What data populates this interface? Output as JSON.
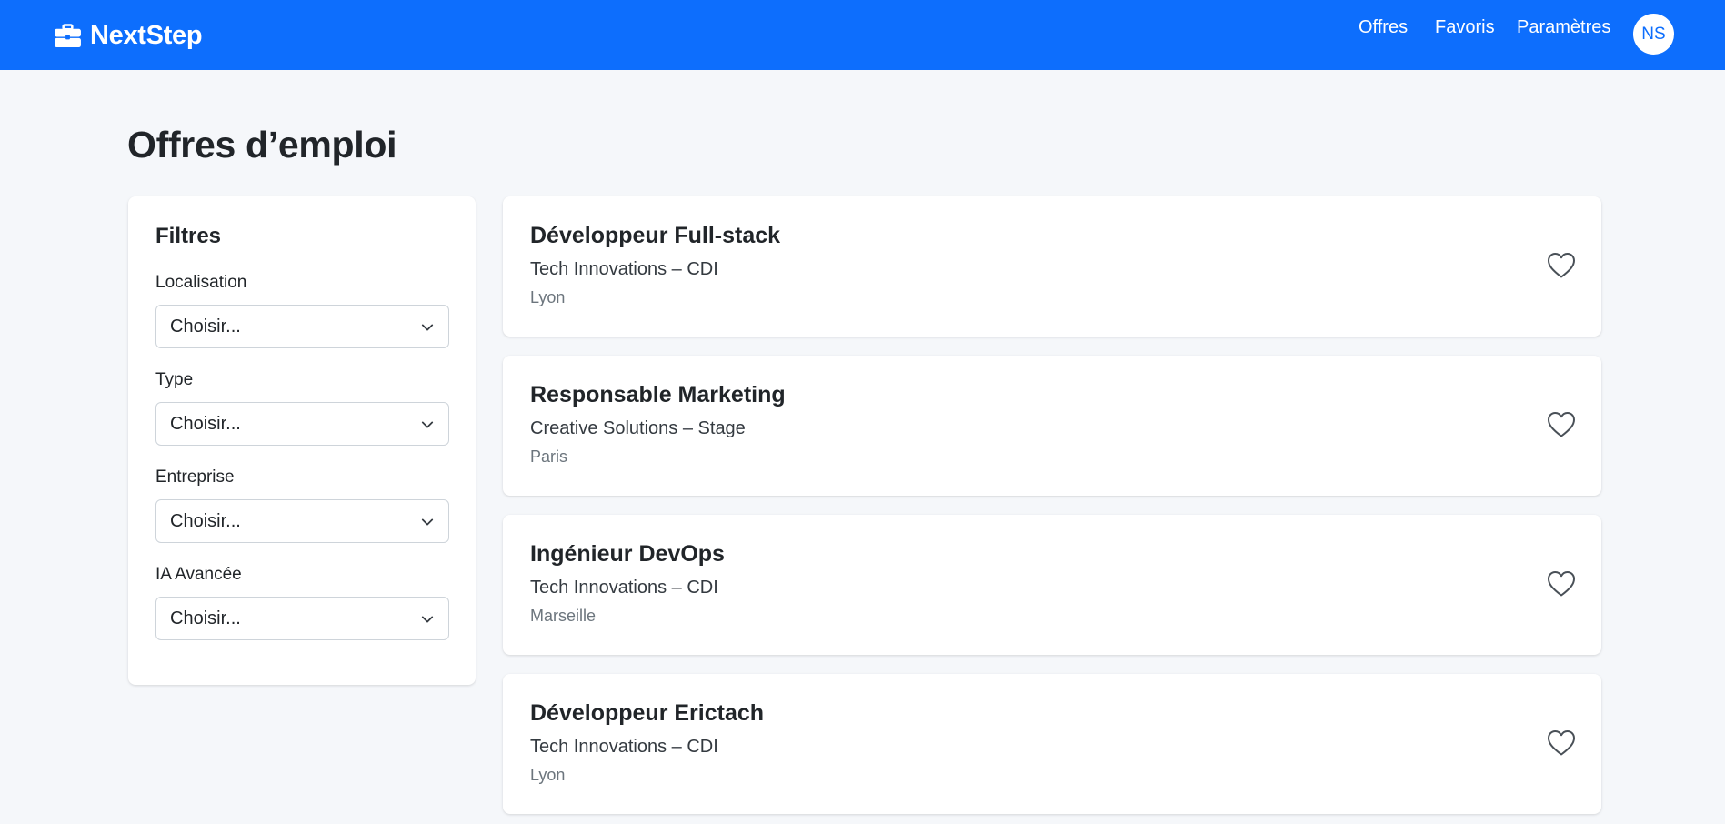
{
  "brand": {
    "name": "NextStep",
    "icon": "briefcase-icon"
  },
  "nav": {
    "links": [
      "Offres",
      "Favoris",
      "Paramètres"
    ],
    "avatar_initials": "NS"
  },
  "page": {
    "title": "Offres d’emploi"
  },
  "filters": {
    "title": "Filtres",
    "items": [
      {
        "label": "Localisation",
        "value": "Choisir..."
      },
      {
        "label": "Type",
        "value": "Choisir..."
      },
      {
        "label": "Entreprise",
        "value": "Choisir..."
      },
      {
        "label": "IA Avancée",
        "value": "Choisir..."
      }
    ]
  },
  "jobs": [
    {
      "title": "Développeur Full-stack",
      "subtitle": "Tech Innovations – CDI",
      "location": "Lyon",
      "favorite_icon": "heart-icon"
    },
    {
      "title": "Responsable Marketing",
      "subtitle": "Creative Solutions – Stage",
      "location": "Paris",
      "favorite_icon": "heart-icon"
    },
    {
      "title": "Ingénieur DevOps",
      "subtitle": "Tech Innovations – CDI",
      "location": "Marseille",
      "favorite_icon": "heart-icon"
    },
    {
      "title": "Développeur Erictach",
      "subtitle": "Tech Innovations – CDI",
      "location": "Lyon",
      "favorite_icon": "heart-icon"
    }
  ],
  "colors": {
    "primary": "#0d6efd",
    "background": "#f5f7fa",
    "muted": "#6c757d"
  }
}
